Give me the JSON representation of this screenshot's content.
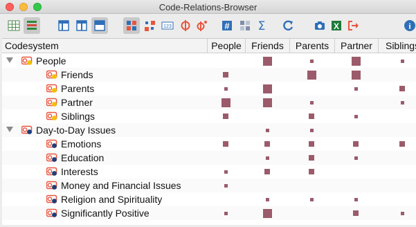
{
  "window": {
    "title": "Code-Relations-Browser"
  },
  "toolbar": {
    "buttons": [
      {
        "icon": "table-grid-icon",
        "active": false
      },
      {
        "icon": "color-stripes-icon",
        "active": true
      },
      {
        "icon": "layout-view-1-icon",
        "active": false
      },
      {
        "icon": "layout-view-2-icon",
        "active": false
      },
      {
        "icon": "layout-view-3-icon",
        "active": true
      },
      {
        "icon": "symbol-squares-icon",
        "active": true
      },
      {
        "icon": "symbol-circles-icon",
        "active": false
      },
      {
        "icon": "numbers-123-icon",
        "active": false
      },
      {
        "icon": "code-relations-icon",
        "active": false
      },
      {
        "icon": "code-relations-alt-icon",
        "active": false
      },
      {
        "icon": "hash-icon",
        "active": false
      },
      {
        "icon": "matrix-abc-icon",
        "active": false
      },
      {
        "icon": "sigma-icon",
        "active": false
      },
      {
        "icon": "refresh-icon",
        "active": false
      },
      {
        "icon": "camera-icon",
        "active": false
      },
      {
        "icon": "excel-export-icon",
        "active": false
      },
      {
        "icon": "export-arrow-icon",
        "active": false
      },
      {
        "icon": "info-icon",
        "active": false
      }
    ]
  },
  "table": {
    "header": {
      "codesystem": "Codesystem",
      "columns": [
        "People",
        "Friends",
        "Parents",
        "Partner",
        "Siblings"
      ]
    },
    "rows": [
      {
        "label": "People",
        "level": 0,
        "expandable": true,
        "group": "people",
        "cells": [
          null,
          "l",
          "s",
          "l",
          "s"
        ]
      },
      {
        "label": "Friends",
        "level": 1,
        "group": "people",
        "cells": [
          "m",
          null,
          "l",
          "l",
          null
        ]
      },
      {
        "label": "Parents",
        "level": 1,
        "group": "people",
        "cells": [
          "s",
          "l",
          null,
          "s",
          "m"
        ]
      },
      {
        "label": "Partner",
        "level": 1,
        "group": "people",
        "cells": [
          "l",
          "l",
          "s",
          null,
          "s"
        ]
      },
      {
        "label": "Siblings",
        "level": 1,
        "group": "people",
        "cells": [
          "m",
          null,
          "m",
          "s",
          null
        ]
      },
      {
        "label": "Day-to-Day Issues",
        "level": 0,
        "expandable": true,
        "group": "issues",
        "cells": [
          null,
          "s",
          "s",
          null,
          null
        ]
      },
      {
        "label": "Emotions",
        "level": 1,
        "group": "issues",
        "cells": [
          "m",
          "m",
          "m",
          "m",
          "m"
        ]
      },
      {
        "label": "Education",
        "level": 1,
        "group": "issues",
        "cells": [
          null,
          "s",
          "m",
          "s",
          null
        ]
      },
      {
        "label": "Interests",
        "level": 1,
        "group": "issues",
        "cells": [
          "s",
          "m",
          "m",
          null,
          null
        ]
      },
      {
        "label": "Money and Financial Issues",
        "level": 1,
        "group": "issues",
        "cells": [
          "s",
          null,
          null,
          null,
          null
        ]
      },
      {
        "label": "Religion and Spirituality",
        "level": 1,
        "group": "issues",
        "cells": [
          null,
          "s",
          "s",
          "s",
          null
        ]
      },
      {
        "label": "Significantly Positive",
        "level": 1,
        "group": "issues",
        "cells": [
          "s",
          "l",
          null,
          "m",
          "s"
        ]
      }
    ]
  },
  "colors": {
    "square": "#9b5b6b",
    "people_dot": "#f2c200",
    "issues_dot": "#1d3f7a",
    "code_red": "#e8553f"
  }
}
